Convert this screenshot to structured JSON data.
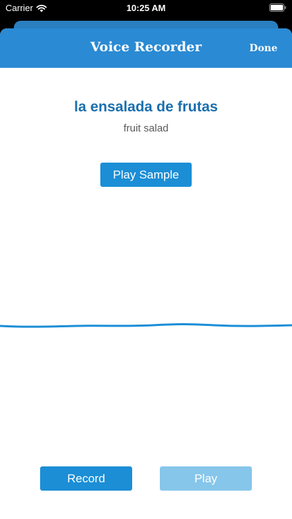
{
  "status_bar": {
    "carrier": "Carrier",
    "time": "10:25 AM",
    "icons": [
      "wifi-icon",
      "battery-icon"
    ]
  },
  "nav": {
    "title": "Voice Recorder",
    "done_label": "Done"
  },
  "content": {
    "word": "la ensalada de frutas",
    "translation": "fruit salad",
    "play_sample_label": "Play Sample"
  },
  "controls": {
    "record_label": "Record",
    "play_label": "Play",
    "play_enabled": false
  },
  "colors": {
    "nav_background": "#2a8ad3",
    "accent": "#1b8ed6",
    "word_text": "#1a6fae",
    "disabled_button": "#86c6ea",
    "waveform": "#1b8ed6"
  }
}
